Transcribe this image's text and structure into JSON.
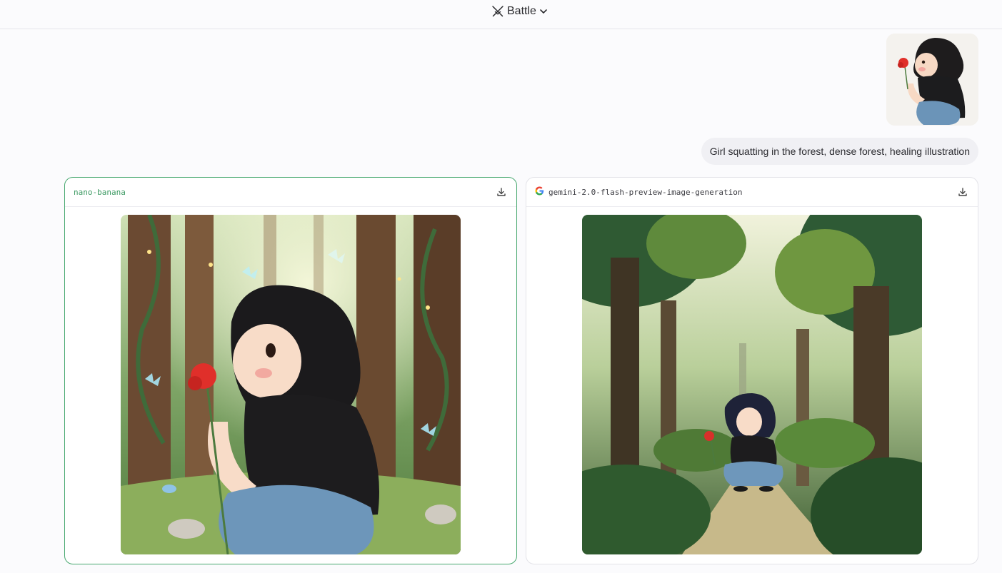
{
  "header": {
    "mode_label": "Battle",
    "mode_icon": "swords-icon",
    "caret_icon": "chevron-down-icon"
  },
  "user_message": {
    "attachment_alt": "girl holding a red flower",
    "prompt": "Girl squatting in the forest, dense forest, healing illustration"
  },
  "responses": [
    {
      "model": "nano-banana",
      "selected": true,
      "download_icon": "download-icon",
      "accent": "#3d9a63"
    },
    {
      "model": "gemini-2.0-flash-preview-image-generation",
      "provider_icon": "google-icon",
      "download_icon": "download-icon"
    }
  ]
}
